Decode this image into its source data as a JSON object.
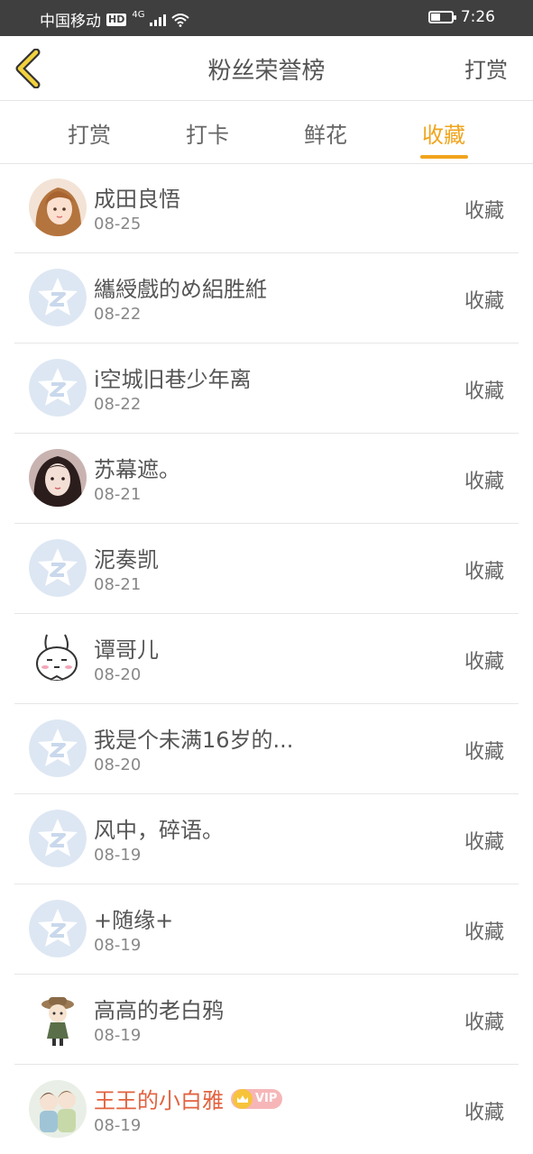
{
  "status_bar": {
    "carrier": "中国移动",
    "hd": "HD",
    "network": "4G",
    "time": "7:26"
  },
  "nav": {
    "title": "粉丝荣誉榜",
    "right_action": "打赏"
  },
  "tabs": [
    {
      "label": "打赏",
      "active": false
    },
    {
      "label": "打卡",
      "active": false
    },
    {
      "label": "鲜花",
      "active": false
    },
    {
      "label": "收藏",
      "active": true
    }
  ],
  "list": [
    {
      "name": "成田良悟",
      "date": "08-25",
      "action": "收藏",
      "avatar": "photo-avatar"
    },
    {
      "name": "纗綬戲的め絽胜絍",
      "date": "08-22",
      "action": "收藏",
      "avatar": "default-star-avatar"
    },
    {
      "name": "i空城旧巷少年离",
      "date": "08-22",
      "action": "收藏",
      "avatar": "default-star-avatar"
    },
    {
      "name": "苏幕遮。",
      "date": "08-21",
      "action": "收藏",
      "avatar": "photo-avatar"
    },
    {
      "name": "泥奏凯",
      "date": "08-21",
      "action": "收藏",
      "avatar": "default-star-avatar"
    },
    {
      "name": "谭哥儿",
      "date": "08-20",
      "action": "收藏",
      "avatar": "rabbit-avatar"
    },
    {
      "name": "我是个未满16岁的...",
      "date": "08-20",
      "action": "收藏",
      "avatar": "default-star-avatar"
    },
    {
      "name": "风中，碎语。",
      "date": "08-19",
      "action": "收藏",
      "avatar": "default-star-avatar"
    },
    {
      "name": "+随缘+",
      "date": "08-19",
      "action": "收藏",
      "avatar": "default-star-avatar"
    },
    {
      "name": "高高的老白鸦",
      "date": "08-19",
      "action": "收藏",
      "avatar": "cartoon-avatar"
    },
    {
      "name": "王王的小白雅",
      "date": "08-19",
      "action": "收藏",
      "avatar": "photo-avatar",
      "vip": "VIP"
    }
  ],
  "colors": {
    "accent": "#f0a41d",
    "vip_name": "#e2623f",
    "text": "#555555",
    "divider": "#e6e6e6",
    "status_bar": "#3f3f3f"
  }
}
